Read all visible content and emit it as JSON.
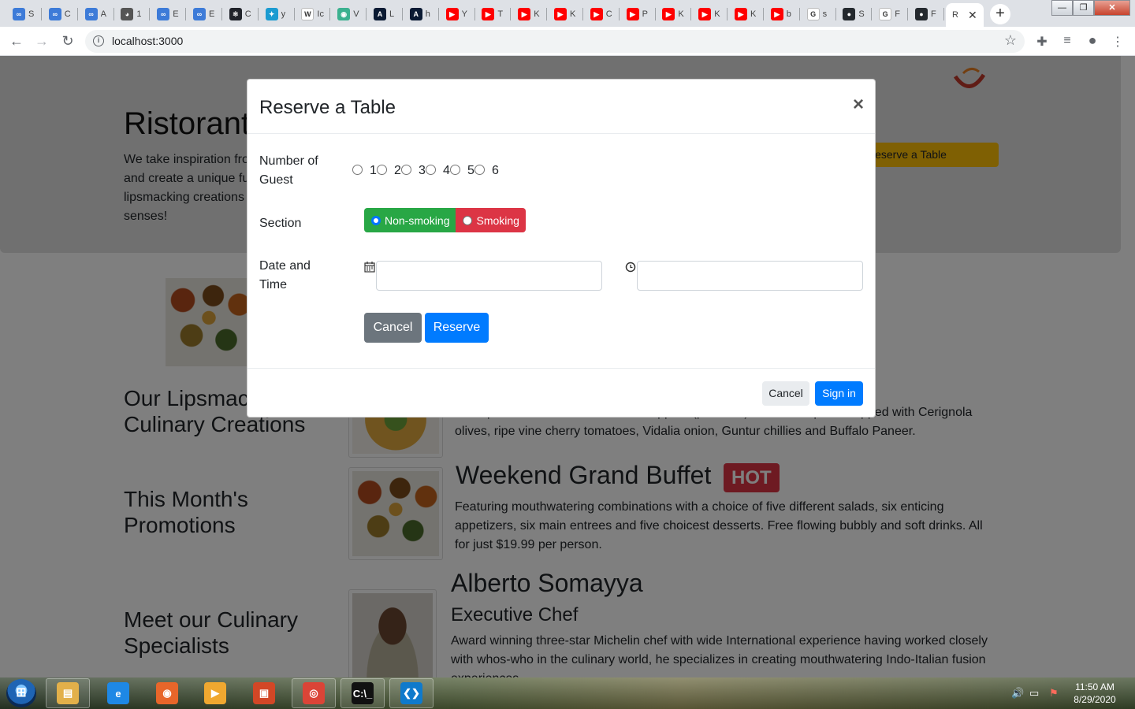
{
  "browser": {
    "tabs": [
      {
        "icon": "infinity-icon",
        "letter": "S",
        "color": "#3d7bd8",
        "fav": "∞"
      },
      {
        "icon": "infinity-icon",
        "letter": "C",
        "color": "#3d7bd8",
        "fav": "∞"
      },
      {
        "icon": "infinity-icon",
        "letter": "A",
        "color": "#3d7bd8",
        "fav": "∞"
      },
      {
        "icon": "globe-icon",
        "letter": "1",
        "color": "#555555",
        "fav": "◕"
      },
      {
        "icon": "infinity-icon",
        "letter": "E",
        "color": "#3d7bd8",
        "fav": "∞"
      },
      {
        "icon": "infinity-icon",
        "letter": "E",
        "color": "#3d7bd8",
        "fav": "∞"
      },
      {
        "icon": "react-icon",
        "letter": "C",
        "color": "#20232a",
        "fav": "⚛"
      },
      {
        "icon": "bird-icon",
        "letter": "y",
        "color": "#1b9bd1",
        "fav": "✦"
      },
      {
        "icon": "wikipedia-icon",
        "letter": "Ic",
        "color": "#ffffff",
        "fav": "W"
      },
      {
        "icon": "colorful-icon",
        "letter": "V",
        "color": "#3bb18f",
        "fav": "◉"
      },
      {
        "icon": "angular-icon",
        "letter": "L",
        "color": "#0a1a33",
        "fav": "A"
      },
      {
        "icon": "angular-icon",
        "letter": "h",
        "color": "#0a1a33",
        "fav": "A"
      },
      {
        "icon": "youtube-icon",
        "letter": "Y",
        "color": "#ff0000",
        "fav": "▶"
      },
      {
        "icon": "youtube-icon",
        "letter": "T",
        "color": "#ff0000",
        "fav": "▶"
      },
      {
        "icon": "youtube-icon",
        "letter": "K",
        "color": "#ff0000",
        "fav": "▶"
      },
      {
        "icon": "youtube-icon",
        "letter": "K",
        "color": "#ff0000",
        "fav": "▶"
      },
      {
        "icon": "youtube-icon",
        "letter": "C",
        "color": "#ff0000",
        "fav": "▶"
      },
      {
        "icon": "youtube-icon",
        "letter": "P",
        "color": "#ff0000",
        "fav": "▶"
      },
      {
        "icon": "youtube-icon",
        "letter": "K",
        "color": "#ff0000",
        "fav": "▶"
      },
      {
        "icon": "youtube-icon",
        "letter": "K",
        "color": "#ff0000",
        "fav": "▶"
      },
      {
        "icon": "youtube-icon",
        "letter": "K",
        "color": "#ff0000",
        "fav": "▶"
      },
      {
        "icon": "youtube-icon",
        "letter": "b",
        "color": "#ff0000",
        "fav": "▶"
      },
      {
        "icon": "google-icon",
        "letter": "s",
        "color": "#ffffff",
        "fav": "G"
      },
      {
        "icon": "github-icon",
        "letter": "S",
        "color": "#24292e",
        "fav": "●"
      },
      {
        "icon": "google-icon",
        "letter": "F",
        "color": "#ffffff",
        "fav": "G"
      },
      {
        "icon": "github-icon",
        "letter": "F",
        "color": "#24292e",
        "fav": "●"
      }
    ],
    "active_tab": {
      "letter": "R",
      "close": "✕"
    },
    "new_tab": "+",
    "url": "localhost:3000"
  },
  "page": {
    "hero_title": "Ristorante con Fusion",
    "hero_text": "We take inspiration from the World's best cuisines, and create a unique fusion experience. Our lipsmacking creations will tickle your culinary senses!",
    "reserve_button": "Reserve a Table",
    "sections": [
      "Our Lipsmacking Culinary Creations",
      "This Month's Promotions",
      "Meet our Culinary Specialists"
    ],
    "dish_text": "A unique combination of Indian Uthappam (pancake) and Italian pizza, topped with Cerignola olives, ripe vine cherry tomatoes, Vidalia onion, Guntur chillies and Buffalo Paneer.",
    "promo_title": "Weekend Grand Buffet",
    "promo_badge": "HOT",
    "promo_text": "Featuring mouthwatering combinations with a choice of five different salads, six enticing appetizers, six main entrees and five choicest desserts. Free flowing bubbly and soft drinks. All for just $19.99 per person.",
    "chef_name": "Alberto Somayya",
    "chef_role": "Executive Chef",
    "chef_text": "Award winning three-star Michelin chef with wide International experience having worked closely with whos-who in the culinary world, he specializes in creating mouthwatering Indo-Italian fusion experiences."
  },
  "modal": {
    "title": "Reserve a Table",
    "close": "×",
    "guests_label": "Number of Guest",
    "guest_options": [
      "1",
      "2",
      "3",
      "4",
      "5",
      "6"
    ],
    "section_label": "Section",
    "section_options": [
      {
        "label": "Non-smoking",
        "selected": true,
        "color": "#28a745"
      },
      {
        "label": "Smoking",
        "selected": false,
        "color": "#dc3545"
      }
    ],
    "datetime_label": "Date and Time",
    "date_value": "",
    "time_value": "",
    "cancel": "Cancel",
    "reserve": "Reserve",
    "footer_cancel": "Cancel",
    "footer_signin": "Sign in"
  },
  "taskbar": {
    "apps": [
      {
        "icon": "explorer-icon",
        "color": "#e2b04a",
        "glyph": "▤"
      },
      {
        "icon": "internet-explorer-icon",
        "color": "#1e88e5",
        "glyph": "e"
      },
      {
        "icon": "firefox-icon",
        "color": "#e8662a",
        "glyph": "◉"
      },
      {
        "icon": "media-player-icon",
        "color": "#f0a830",
        "glyph": "▶"
      },
      {
        "icon": "office-icon",
        "color": "#d24726",
        "glyph": "▣"
      },
      {
        "icon": "chrome-icon",
        "color": "#db4437",
        "glyph": "◎"
      },
      {
        "icon": "terminal-icon",
        "color": "#111111",
        "glyph": "C:\\_"
      },
      {
        "icon": "vscode-icon",
        "color": "#0f7acc",
        "glyph": "❮❯"
      }
    ],
    "time": "11:50 AM",
    "date": "8/29/2020"
  }
}
